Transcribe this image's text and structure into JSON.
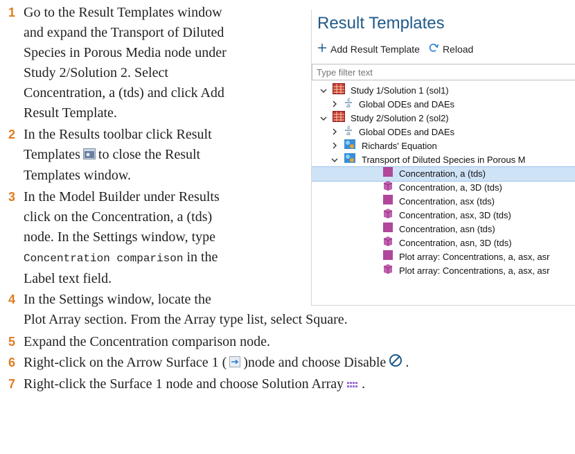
{
  "steps": [
    {
      "num": "1",
      "lines": [
        "Go to the Result Templates window",
        "and expand the Transport of Diluted",
        "Species in Porous Media node under",
        "Study 2/Solution 2. Select",
        "Concentration, a (tds) and click Add",
        "Result Template."
      ]
    },
    {
      "num": "2",
      "line1": "In the Results toolbar click Result",
      "line2a": "Templates",
      "line2b": "to close the Result",
      "line3": "Templates window."
    },
    {
      "num": "3",
      "line1": "In the Model Builder under Results",
      "line2": "click on the Concentration, a (tds)",
      "line3": "node. In the Settings window, type",
      "code": "Concentration comparison",
      "line4b": "in the",
      "line5": "Label text field."
    },
    {
      "num": "4",
      "line1": "In the Settings window, locate the",
      "line2": "Plot Array section. From the Array type list, select Square."
    },
    {
      "num": "5",
      "line1": "Expand the Concentration comparison node."
    },
    {
      "num": "6",
      "line1a": "Right-click on the Arrow Surface 1 (",
      "line1b": ")node and choose Disable",
      "line1c": "."
    },
    {
      "num": "7",
      "line1a": "Right-click the Surface 1 node and choose Solution Array",
      "line1b": "."
    }
  ],
  "panel": {
    "title": "Result Templates",
    "add_label": "Add Result Template",
    "reload_label": "Reload",
    "filter_placeholder": "Type filter text",
    "tree": [
      {
        "label": "Study 1/Solution 1 (sol1)",
        "level": 0,
        "chev": "v",
        "icon": "study-icon"
      },
      {
        "label": "Global ODEs and DAEs",
        "level": 1,
        "chev": ">",
        "icon": "ode-icon"
      },
      {
        "label": "Study 2/Solution 2 (sol2)",
        "level": 0,
        "chev": "v",
        "icon": "study-icon"
      },
      {
        "label": "Global ODEs and DAEs",
        "level": 1,
        "chev": ">",
        "icon": "ode-icon"
      },
      {
        "label": "Richards' Equation",
        "level": 1,
        "chev": ">",
        "icon": "physics-icon"
      },
      {
        "label": "Transport of Diluted Species in Porous M",
        "level": 1,
        "chev": "v",
        "icon": "physics-icon"
      },
      {
        "label": "Concentration, a (tds)",
        "level": 2,
        "chev": "",
        "icon": "plot2d-icon",
        "selected": true
      },
      {
        "label": "Concentration, a, 3D (tds)",
        "level": 2,
        "chev": "",
        "icon": "plot3d-icon"
      },
      {
        "label": "Concentration, asx (tds)",
        "level": 2,
        "chev": "",
        "icon": "plot2d-icon"
      },
      {
        "label": "Concentration, asx, 3D (tds)",
        "level": 2,
        "chev": "",
        "icon": "plot3d-icon"
      },
      {
        "label": "Concentration, asn (tds)",
        "level": 2,
        "chev": "",
        "icon": "plot2d-icon"
      },
      {
        "label": "Concentration, asn, 3D (tds)",
        "level": 2,
        "chev": "",
        "icon": "plot3d-icon"
      },
      {
        "label": "Plot array: Concentrations, a, asx, asr",
        "level": 2,
        "chev": "",
        "icon": "plot2d-icon"
      },
      {
        "label": "Plot array: Concentrations, a, asx, asr",
        "level": 2,
        "chev": "",
        "icon": "plot3d-icon"
      }
    ]
  }
}
